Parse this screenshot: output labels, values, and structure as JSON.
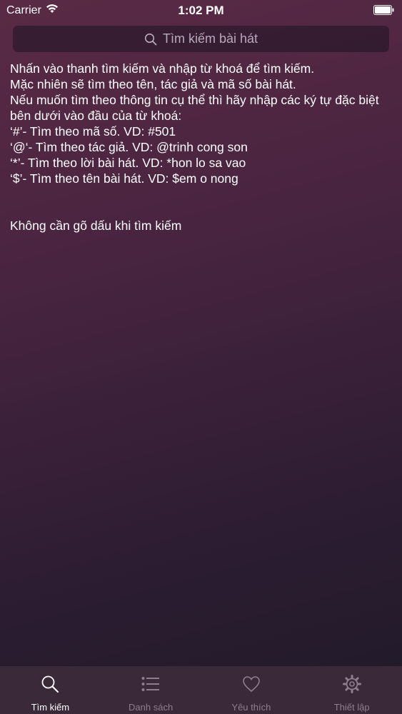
{
  "status_bar": {
    "carrier": "Carrier",
    "time": "1:02 PM",
    "icons": [
      "wifi-icon",
      "battery-icon"
    ]
  },
  "search": {
    "placeholder": "Tìm kiếm bài hát",
    "icon": "search-icon"
  },
  "instructions": {
    "lines": [
      "Nhấn vào thanh tìm kiếm và nhập từ khoá để tìm kiếm.",
      "Mặc nhiên sẽ tìm theo tên, tác giả và mã số bài hát.",
      "Nếu muốn tìm theo thông tin cụ thể thì hãy nhập các ký tự đặc biệt bên dưới vào đầu của từ khoá:",
      "‘#’- Tìm theo mã số. VD: #501",
      "‘@‘- Tìm theo tác giả. VD: @trinh cong son",
      "‘*’- Tìm theo lời bài hát. VD: *hon lo sa vao",
      "‘$’- Tìm theo tên bài hát. VD: $em o nong"
    ],
    "note": "Không cần gõ dấu khi tìm kiếm"
  },
  "tabs": [
    {
      "label": "Tìm kiếm",
      "icon": "search-icon",
      "active": true
    },
    {
      "label": "Danh sách",
      "icon": "list-icon",
      "active": false
    },
    {
      "label": "Yêu thích",
      "icon": "heart-icon",
      "active": false
    },
    {
      "label": "Thiết lập",
      "icon": "gear-icon",
      "active": false
    }
  ],
  "colors": {
    "background_top": "#5a2a45",
    "background_bottom": "#1f1a28",
    "tab_active": "#ffffff",
    "tab_inactive": "#8d7d8d"
  }
}
